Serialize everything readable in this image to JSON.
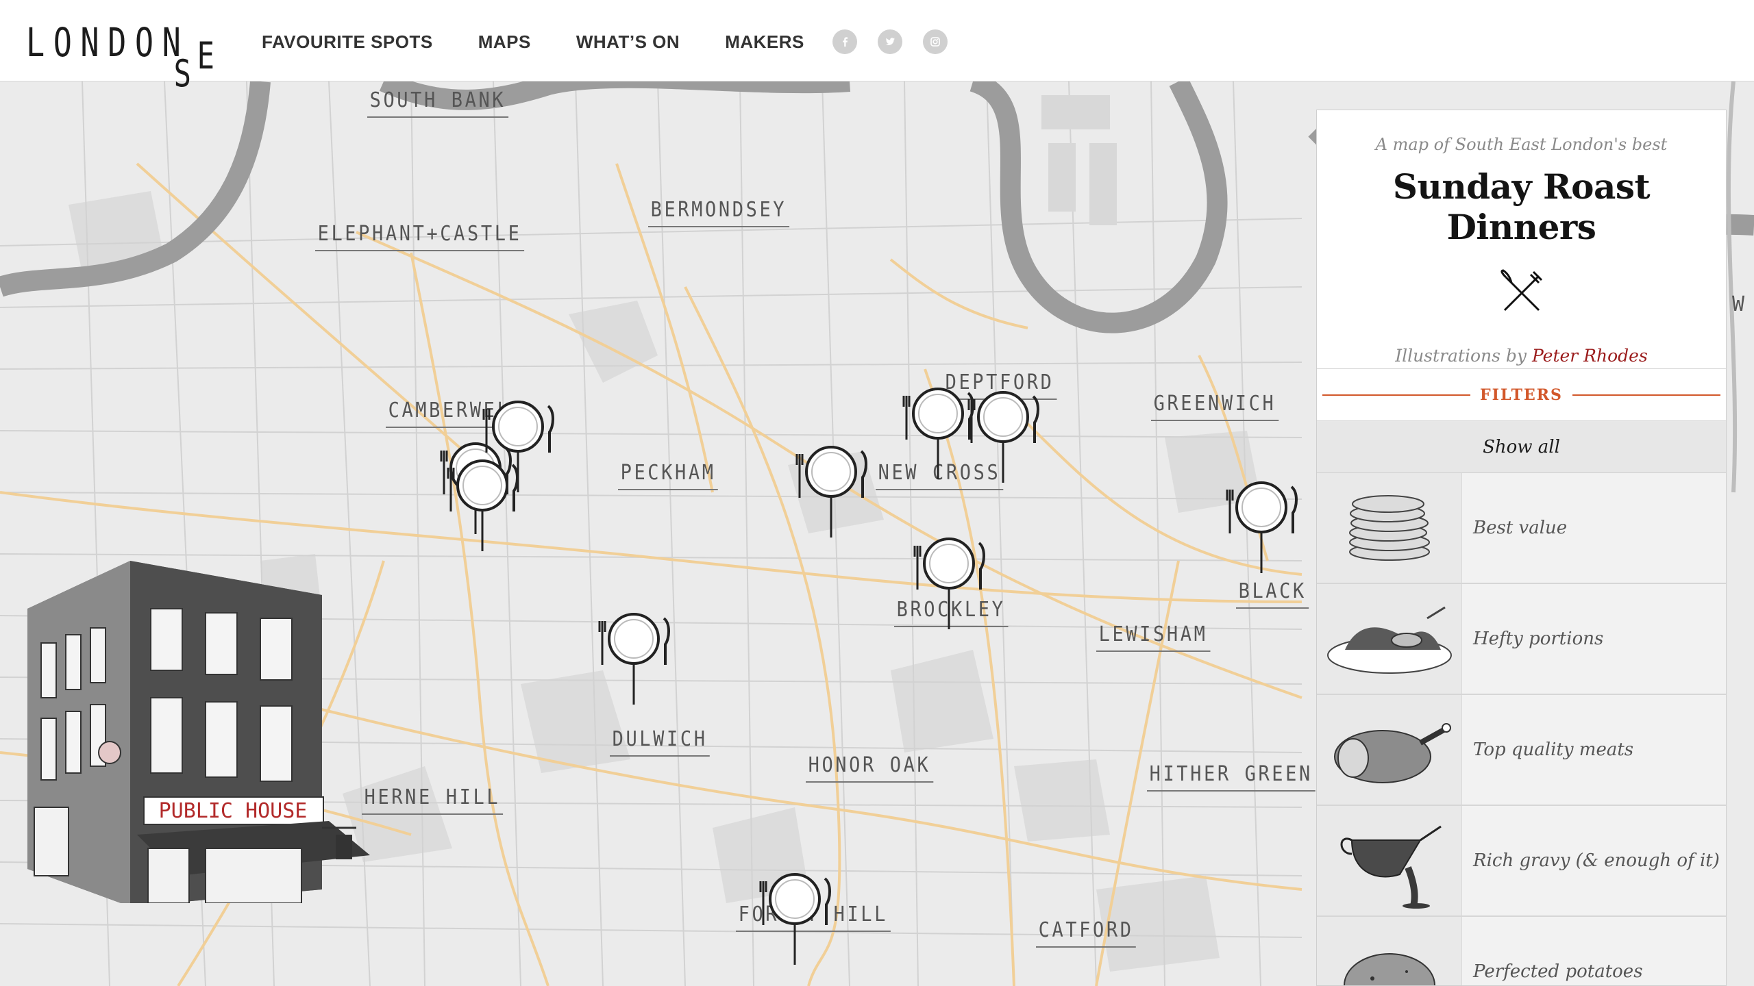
{
  "header": {
    "logo_main": "LONDON",
    "logo_s": "S",
    "logo_e": "E",
    "nav": [
      "FAVOURITE SPOTS",
      "MAPS",
      "WHAT’S ON",
      "MAKERS"
    ],
    "social": [
      "facebook-icon",
      "twitter-icon",
      "instagram-icon"
    ]
  },
  "map": {
    "places": [
      "SOUTH BANK",
      "BERMONDSEY",
      "ELEPHANT+CASTLE",
      "DEPTFORD",
      "CAMBERWELL",
      "GREENWICH",
      "PECKHAM",
      "NEW CROSS",
      "BROCKLEY",
      "LEWISHAM",
      "BLACK",
      "DULWICH",
      "HONOR OAK",
      "HERNE HILL",
      "HITHER GREEN",
      "FOREST HILL",
      "CATFORD"
    ],
    "illustration_sign": "PUBLIC HOUSE",
    "pin_icon": "plate-cutlery-pin-icon"
  },
  "panel": {
    "subtitle": "A map of South East London's best",
    "title": "Sunday Roast Dinners",
    "title_icon": "fork-knife-crossed-icon",
    "credit_prefix": "Illustrations by",
    "credit_name": "Peter Rhodes",
    "filters_label": "FILTERS",
    "show_all": "Show all",
    "filters": [
      {
        "label": "Best value",
        "icon": "coins-stack-icon"
      },
      {
        "label": "Hefty portions",
        "icon": "heaped-plate-icon"
      },
      {
        "label": "Top quality meats",
        "icon": "roast-chicken-icon"
      },
      {
        "label": "Rich gravy (& enough of it)",
        "icon": "gravy-boat-icon"
      },
      {
        "label": "Perfected potatoes",
        "icon": "potato-icon"
      }
    ]
  },
  "colors": {
    "accent": "#d2572a",
    "credit_link": "#9b1c1c",
    "road": "#f1cf97",
    "river": "#9c9c9c"
  }
}
